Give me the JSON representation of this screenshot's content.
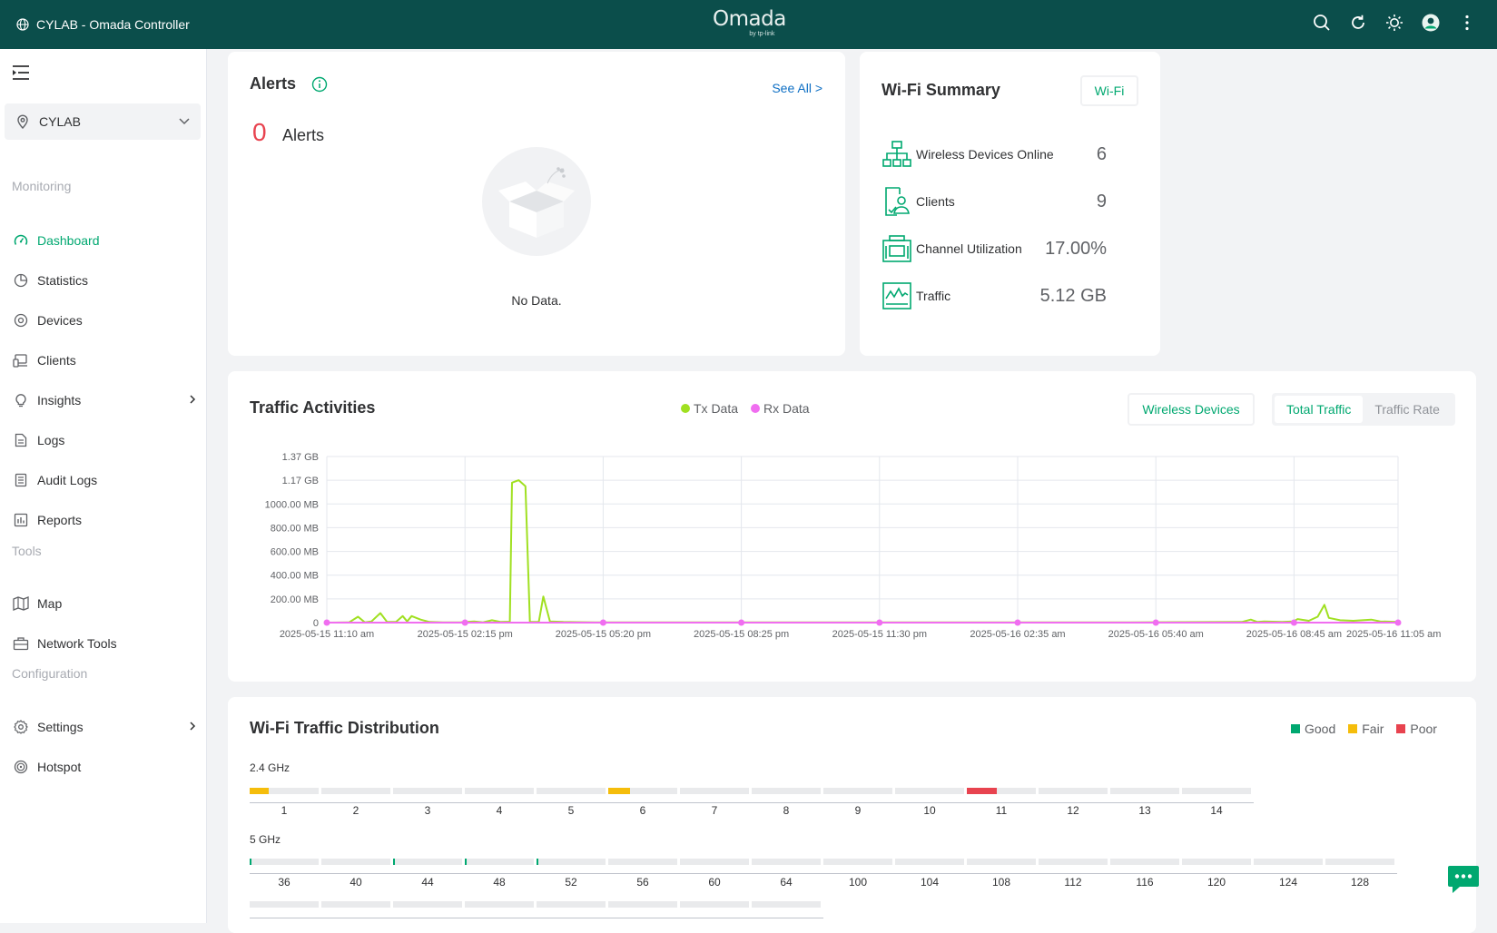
{
  "topbar": {
    "site_title": "CYLAB - Omada Controller",
    "brand": "Omada",
    "brand_sub": "by tp-link",
    "icons": [
      "search-icon",
      "refresh-icon",
      "theme-icon",
      "avatar",
      "more-icon"
    ]
  },
  "sidebar": {
    "site": "CYLAB",
    "sections": {
      "monitoring": "Monitoring",
      "tools": "Tools",
      "configuration": "Configuration"
    },
    "items": [
      {
        "label": "Dashboard",
        "icon": "dashboard-icon",
        "active": true
      },
      {
        "label": "Statistics",
        "icon": "statistics-icon"
      },
      {
        "label": "Devices",
        "icon": "devices-icon"
      },
      {
        "label": "Clients",
        "icon": "clients-icon"
      },
      {
        "label": "Insights",
        "icon": "insights-icon"
      },
      {
        "label": "Logs",
        "icon": "logs-icon"
      },
      {
        "label": "Audit Logs",
        "icon": "audit-logs-icon"
      },
      {
        "label": "Reports",
        "icon": "reports-icon"
      },
      {
        "label": "Map",
        "icon": "map-icon"
      },
      {
        "label": "Network Tools",
        "icon": "network-tools-icon"
      },
      {
        "label": "Settings",
        "icon": "settings-icon"
      },
      {
        "label": "Hotspot",
        "icon": "hotspot-icon"
      }
    ]
  },
  "alerts": {
    "title": "Alerts",
    "see_all": "See All >",
    "count": "0",
    "count_label": "Alerts",
    "no_data": "No Data."
  },
  "wifi_summary": {
    "title": "Wi-Fi Summary",
    "button": "Wi-Fi",
    "rows": [
      {
        "label": "Wireless Devices Online",
        "value": "6"
      },
      {
        "label": "Clients",
        "value": "9"
      },
      {
        "label": "Channel Utilization",
        "value": "17.00%"
      },
      {
        "label": "Traffic",
        "value": "5.12 GB"
      }
    ]
  },
  "traffic": {
    "title": "Traffic Activities",
    "scope_button": "Wireless Devices",
    "toggle": [
      "Total Traffic",
      "Traffic Rate"
    ],
    "colors": {
      "tx": "#a0e021",
      "rx": "#f06ef0"
    }
  },
  "chart_data": {
    "type": "line",
    "title": "Traffic Activities",
    "y_ticks": [
      "0",
      "200.00 MB",
      "400.00 MB",
      "600.00 MB",
      "800.00 MB",
      "1000.00 MB",
      "1.17 GB",
      "1.37 GB"
    ],
    "x_ticks": [
      "2025-05-15 11:10 am",
      "2025-05-15 02:15 pm",
      "2025-05-15 05:20 pm",
      "2025-05-15 08:25 pm",
      "2025-05-15 11:30 pm",
      "2025-05-16 02:35 am",
      "2025-05-16 05:40 am",
      "2025-05-16 08:45 am",
      "2025-05-16 11:05 am"
    ],
    "ylim_mb": [
      0,
      1400
    ],
    "x_hours_range": [
      0,
      24
    ],
    "series": [
      {
        "name": "Tx Data",
        "points": [
          [
            0,
            0
          ],
          [
            0.5,
            2
          ],
          [
            0.7,
            50
          ],
          [
            0.85,
            2
          ],
          [
            1.0,
            10
          ],
          [
            1.2,
            80
          ],
          [
            1.35,
            5
          ],
          [
            1.55,
            5
          ],
          [
            1.7,
            55
          ],
          [
            1.8,
            10
          ],
          [
            1.9,
            55
          ],
          [
            2.1,
            25
          ],
          [
            2.3,
            5
          ],
          [
            2.6,
            2
          ],
          [
            3.0,
            3
          ],
          [
            3.3,
            10
          ],
          [
            3.5,
            2
          ],
          [
            3.7,
            20
          ],
          [
            3.9,
            5
          ],
          [
            4.1,
            8
          ],
          [
            4.15,
            1180
          ],
          [
            4.3,
            1200
          ],
          [
            4.45,
            1150
          ],
          [
            4.55,
            5
          ],
          [
            4.75,
            5
          ],
          [
            4.85,
            220
          ],
          [
            5.0,
            10
          ],
          [
            5.3,
            5
          ],
          [
            6.0,
            2
          ],
          [
            9.0,
            2
          ],
          [
            12.0,
            2
          ],
          [
            15.0,
            2
          ],
          [
            18.0,
            2
          ],
          [
            20.5,
            5
          ],
          [
            20.7,
            25
          ],
          [
            20.85,
            5
          ],
          [
            21.0,
            10
          ],
          [
            21.4,
            5
          ],
          [
            21.65,
            10
          ],
          [
            21.75,
            30
          ],
          [
            22.0,
            15
          ],
          [
            22.2,
            50
          ],
          [
            22.35,
            150
          ],
          [
            22.45,
            40
          ],
          [
            22.7,
            20
          ],
          [
            23.0,
            15
          ],
          [
            23.4,
            25
          ],
          [
            23.6,
            10
          ],
          [
            24,
            5
          ]
        ]
      },
      {
        "name": "Rx Data",
        "points": [
          [
            0,
            0
          ],
          [
            24,
            0
          ]
        ]
      }
    ]
  },
  "distribution": {
    "title": "Wi-Fi Traffic Distribution",
    "legend": [
      {
        "label": "Good",
        "color": "#00a870"
      },
      {
        "label": "Fair",
        "color": "#f5bd0b"
      },
      {
        "label": "Poor",
        "color": "#e8434f"
      }
    ],
    "band_24": {
      "label": "2.4 GHz",
      "channels": [
        "1",
        "2",
        "3",
        "4",
        "5",
        "6",
        "7",
        "8",
        "9",
        "10",
        "11",
        "12",
        "13",
        "14"
      ],
      "fill_fractions": [
        0.27,
        0,
        0,
        0,
        0,
        0.31,
        0,
        0,
        0,
        0,
        0.44,
        0,
        0,
        0
      ],
      "fill_colors": [
        "#f5bd0b",
        "",
        "",
        "",
        "",
        "#f5bd0b",
        "",
        "",
        "",
        "",
        "#e8434f",
        "",
        "",
        ""
      ]
    },
    "band_5": {
      "label": "5 GHz",
      "channels": [
        "36",
        "40",
        "44",
        "48",
        "52",
        "56",
        "60",
        "64",
        "100",
        "104",
        "108",
        "112",
        "116",
        "120",
        "124",
        "128"
      ],
      "fill_fractions": [
        0.03,
        0,
        0.03,
        0.03,
        0.02,
        0,
        0,
        0,
        0,
        0,
        0,
        0,
        0,
        0,
        0,
        0
      ],
      "fill_color": "#00a870",
      "second_row_count": 8
    }
  }
}
